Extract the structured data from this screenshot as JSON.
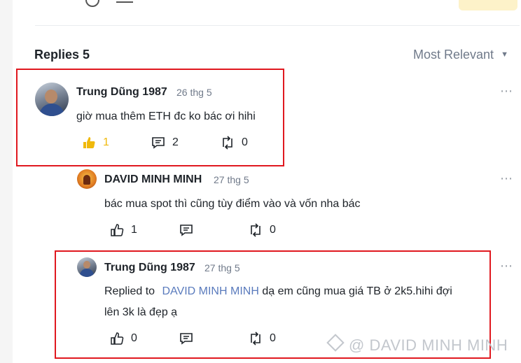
{
  "header": {
    "replies_title": "Replies 5",
    "sort_label": "Most Relevant"
  },
  "comments": [
    {
      "author": "Trung Dũng 1987",
      "date": "26 thg 5",
      "text": "giờ mua thêm ETH đc ko bác ơi hihi",
      "likes": "1",
      "comments": "2",
      "reposts": "0",
      "liked": true
    },
    {
      "author": "DAVID MINH MINH",
      "date": "27 thg 5",
      "text": "bác mua spot thì cũng tùy điểm vào và vốn nha bác",
      "likes": "1",
      "comments": "",
      "reposts": "0",
      "liked": false
    },
    {
      "author": "Trung Dũng 1987",
      "date": "27 thg 5",
      "replied_prefix": "Replied to",
      "replied_to": "DAVID MINH MINH",
      "text_line1": "dạ em cũng mua giá TB ở 2k5.hihi đợi",
      "text_line2": "lên 3k là đẹp ạ",
      "likes": "0",
      "comments": "",
      "reposts": "0",
      "liked": false
    }
  ],
  "more_icon": "⋯",
  "watermark": "@ DAVID MINH MINH",
  "colors": {
    "accent": "#f0b90b",
    "highlight_box": "#e0181f",
    "mention": "#5a7bbd"
  },
  "icons": [
    "thumbs-up-icon",
    "comment-icon",
    "repost-icon",
    "more-options-icon",
    "chevron-down-icon"
  ]
}
